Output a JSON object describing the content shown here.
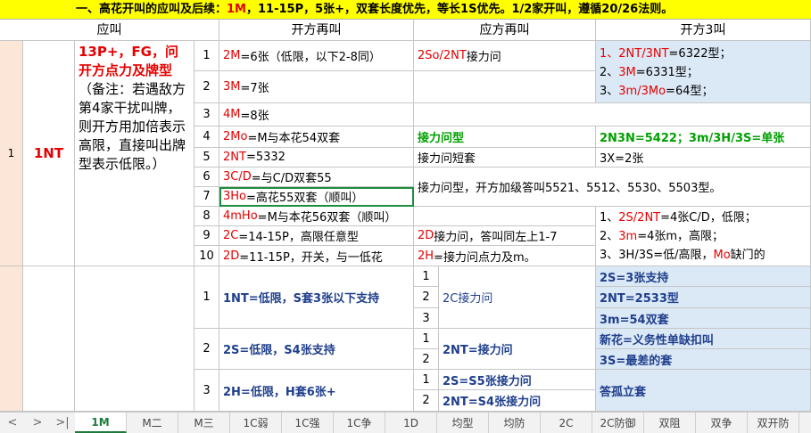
{
  "banner": {
    "part1": "一、高花开叫的应叫及后续：",
    "part2": "1M",
    "part3": "，11-15P，5张+，双套长度优先，等长1S优先。1/2家开叫，遵循20/26法则。"
  },
  "headers": {
    "col1": "应叫",
    "col2": "开方再叫",
    "col3": "应方再叫",
    "col4": "开方3叫"
  },
  "section1": {
    "row_label": "1",
    "bid": "1NT",
    "desc_red": "13P+，FG，问开方点力及牌型",
    "desc_rest": "（备注：若遇敌方第4家干扰叫牌，则开方用加倍表示高限，直接叫出牌型表示低限。）",
    "rows": [
      {
        "n": "1",
        "k": "2M",
        "t": "=6张（低限，以下2-8同）"
      },
      {
        "n": "2",
        "k": "3M",
        "t": "=7张"
      },
      {
        "n": "3",
        "k": "4M",
        "t": "=8张"
      },
      {
        "n": "4",
        "k": "2Mo",
        "t": "=M与本花54双套"
      },
      {
        "n": "5",
        "k": "2NT",
        "t": "=5332"
      },
      {
        "n": "6",
        "k": "3C/D",
        "t": "=与C/D双套55"
      },
      {
        "n": "7",
        "k": "3Ho",
        "t": "=高花55双套（顺叫）"
      },
      {
        "n": "8",
        "k": "4mHo",
        "t": "=M与本花56双套（顺叫）"
      },
      {
        "n": "9",
        "k": "2C",
        "t": "=14-15P，高限任意型"
      },
      {
        "n": "10",
        "k": "2D",
        "t": "=11-15P，开关，与一低花"
      }
    ],
    "resp": {
      "r1_k": "2So/2NT",
      "r1_t": "接力问",
      "r4": "接力问型",
      "r5": "接力问短套",
      "r67": "接力问型，开方加级答叫5521、5512、5530、5503型。",
      "r9_k": "2D",
      "r9_t": "接力问，答叫同左上1-7",
      "r10_k": "2H",
      "r10_t": "=接力问点力及m。"
    },
    "third": {
      "a1_k": "1、2NT/3NT",
      "a1_t": "=6322型；",
      "a2_pre": "2、",
      "a2_k": "3M",
      "a2_t": "=6331型；",
      "a3_pre": "3、",
      "a3_k": "3m/3Mo",
      "a3_t": "=64型；",
      "r4": "2N3N=5422；3m/3H/3S=单张",
      "r5": "3X=2张",
      "b1_pre": "1、",
      "b1_k": "2S/2NT",
      "b1_t": "=4张C/D，低限；",
      "b2_pre": "2、",
      "b2_k": "3m",
      "b2_t": "=4张m，高限；",
      "b3_pre": "3、3H/3S=低/高限，",
      "b3_k": "Mo",
      "b3_t": "缺门的"
    }
  },
  "section2": {
    "groups": [
      {
        "n": "1",
        "t": "1NT=低限，S套3张以下支持",
        "sub": [
          "1",
          "2",
          "3"
        ],
        "resp": "2C接力问",
        "third": [
          "2S=3张支持",
          "2NT=2533型",
          "3m=54双套"
        ]
      },
      {
        "n": "2",
        "t": "2S=低限，S4张支持",
        "sub": [
          "1",
          "2"
        ],
        "resp": "2NT=接力问",
        "third": [
          "新花=义务性单缺扣叫",
          "3S=最差的套"
        ]
      },
      {
        "n": "3",
        "t": "2H=低限，H套6张+",
        "sub": [
          "1",
          "2"
        ],
        "resp2": [
          "2S=S5张接力问",
          "2NT=S4张接力问"
        ],
        "third": [
          "答孤立套"
        ]
      }
    ]
  },
  "tabs": {
    "nav_prev": "<",
    "nav_next": ">",
    "nav_last": ">|",
    "items": [
      "1M",
      "M二",
      "M三",
      "1C弱",
      "1C强",
      "1C争",
      "1D",
      "均型",
      "均防",
      "2C",
      "2C防御",
      "双阻",
      "双争",
      "双开防"
    ]
  }
}
